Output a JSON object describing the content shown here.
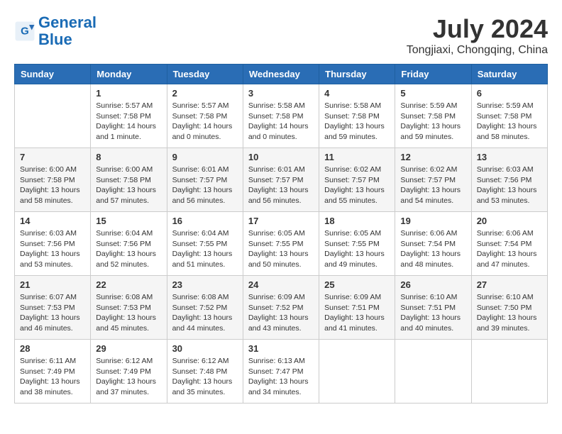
{
  "header": {
    "logo_line1": "General",
    "logo_line2": "Blue",
    "month": "July 2024",
    "location": "Tongjiaxi, Chongqing, China"
  },
  "days_of_week": [
    "Sunday",
    "Monday",
    "Tuesday",
    "Wednesday",
    "Thursday",
    "Friday",
    "Saturday"
  ],
  "weeks": [
    [
      {
        "day": "",
        "info": ""
      },
      {
        "day": "1",
        "info": "Sunrise: 5:57 AM\nSunset: 7:58 PM\nDaylight: 14 hours\nand 1 minute."
      },
      {
        "day": "2",
        "info": "Sunrise: 5:57 AM\nSunset: 7:58 PM\nDaylight: 14 hours\nand 0 minutes."
      },
      {
        "day": "3",
        "info": "Sunrise: 5:58 AM\nSunset: 7:58 PM\nDaylight: 14 hours\nand 0 minutes."
      },
      {
        "day": "4",
        "info": "Sunrise: 5:58 AM\nSunset: 7:58 PM\nDaylight: 13 hours\nand 59 minutes."
      },
      {
        "day": "5",
        "info": "Sunrise: 5:59 AM\nSunset: 7:58 PM\nDaylight: 13 hours\nand 59 minutes."
      },
      {
        "day": "6",
        "info": "Sunrise: 5:59 AM\nSunset: 7:58 PM\nDaylight: 13 hours\nand 58 minutes."
      }
    ],
    [
      {
        "day": "7",
        "info": "Sunrise: 6:00 AM\nSunset: 7:58 PM\nDaylight: 13 hours\nand 58 minutes."
      },
      {
        "day": "8",
        "info": "Sunrise: 6:00 AM\nSunset: 7:58 PM\nDaylight: 13 hours\nand 57 minutes."
      },
      {
        "day": "9",
        "info": "Sunrise: 6:01 AM\nSunset: 7:57 PM\nDaylight: 13 hours\nand 56 minutes."
      },
      {
        "day": "10",
        "info": "Sunrise: 6:01 AM\nSunset: 7:57 PM\nDaylight: 13 hours\nand 56 minutes."
      },
      {
        "day": "11",
        "info": "Sunrise: 6:02 AM\nSunset: 7:57 PM\nDaylight: 13 hours\nand 55 minutes."
      },
      {
        "day": "12",
        "info": "Sunrise: 6:02 AM\nSunset: 7:57 PM\nDaylight: 13 hours\nand 54 minutes."
      },
      {
        "day": "13",
        "info": "Sunrise: 6:03 AM\nSunset: 7:56 PM\nDaylight: 13 hours\nand 53 minutes."
      }
    ],
    [
      {
        "day": "14",
        "info": "Sunrise: 6:03 AM\nSunset: 7:56 PM\nDaylight: 13 hours\nand 53 minutes."
      },
      {
        "day": "15",
        "info": "Sunrise: 6:04 AM\nSunset: 7:56 PM\nDaylight: 13 hours\nand 52 minutes."
      },
      {
        "day": "16",
        "info": "Sunrise: 6:04 AM\nSunset: 7:55 PM\nDaylight: 13 hours\nand 51 minutes."
      },
      {
        "day": "17",
        "info": "Sunrise: 6:05 AM\nSunset: 7:55 PM\nDaylight: 13 hours\nand 50 minutes."
      },
      {
        "day": "18",
        "info": "Sunrise: 6:05 AM\nSunset: 7:55 PM\nDaylight: 13 hours\nand 49 minutes."
      },
      {
        "day": "19",
        "info": "Sunrise: 6:06 AM\nSunset: 7:54 PM\nDaylight: 13 hours\nand 48 minutes."
      },
      {
        "day": "20",
        "info": "Sunrise: 6:06 AM\nSunset: 7:54 PM\nDaylight: 13 hours\nand 47 minutes."
      }
    ],
    [
      {
        "day": "21",
        "info": "Sunrise: 6:07 AM\nSunset: 7:53 PM\nDaylight: 13 hours\nand 46 minutes."
      },
      {
        "day": "22",
        "info": "Sunrise: 6:08 AM\nSunset: 7:53 PM\nDaylight: 13 hours\nand 45 minutes."
      },
      {
        "day": "23",
        "info": "Sunrise: 6:08 AM\nSunset: 7:52 PM\nDaylight: 13 hours\nand 44 minutes."
      },
      {
        "day": "24",
        "info": "Sunrise: 6:09 AM\nSunset: 7:52 PM\nDaylight: 13 hours\nand 43 minutes."
      },
      {
        "day": "25",
        "info": "Sunrise: 6:09 AM\nSunset: 7:51 PM\nDaylight: 13 hours\nand 41 minutes."
      },
      {
        "day": "26",
        "info": "Sunrise: 6:10 AM\nSunset: 7:51 PM\nDaylight: 13 hours\nand 40 minutes."
      },
      {
        "day": "27",
        "info": "Sunrise: 6:10 AM\nSunset: 7:50 PM\nDaylight: 13 hours\nand 39 minutes."
      }
    ],
    [
      {
        "day": "28",
        "info": "Sunrise: 6:11 AM\nSunset: 7:49 PM\nDaylight: 13 hours\nand 38 minutes."
      },
      {
        "day": "29",
        "info": "Sunrise: 6:12 AM\nSunset: 7:49 PM\nDaylight: 13 hours\nand 37 minutes."
      },
      {
        "day": "30",
        "info": "Sunrise: 6:12 AM\nSunset: 7:48 PM\nDaylight: 13 hours\nand 35 minutes."
      },
      {
        "day": "31",
        "info": "Sunrise: 6:13 AM\nSunset: 7:47 PM\nDaylight: 13 hours\nand 34 minutes."
      },
      {
        "day": "",
        "info": ""
      },
      {
        "day": "",
        "info": ""
      },
      {
        "day": "",
        "info": ""
      }
    ]
  ]
}
